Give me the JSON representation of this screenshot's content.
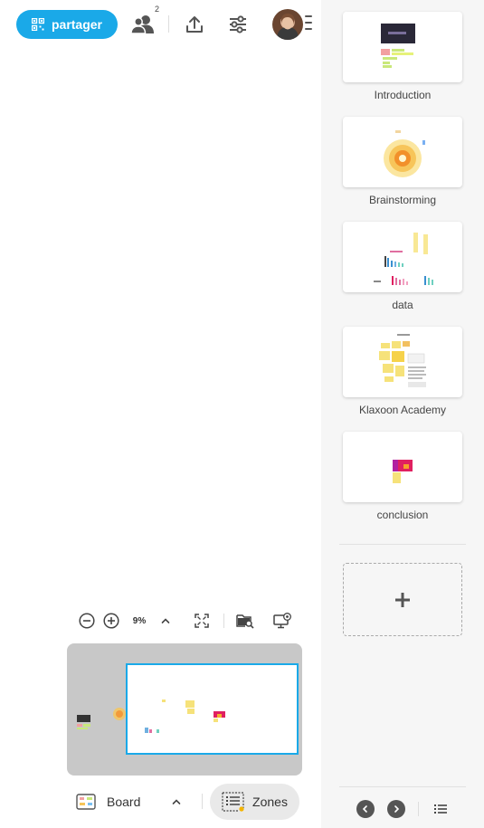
{
  "toolbar": {
    "share_label": "partager",
    "users_count": "2"
  },
  "zoom": {
    "level": "9%"
  },
  "bottom": {
    "board_label": "Board",
    "zones_label": "Zones"
  },
  "zones": [
    {
      "label": "Introduction"
    },
    {
      "label": "Brainstorming"
    },
    {
      "label": "data"
    },
    {
      "label": "Klaxoon Academy"
    },
    {
      "label": "conclusion"
    }
  ],
  "add_zone_symbol": "+",
  "colors": {
    "accent": "#1aa9e8",
    "panel_bg": "#f6f6f6",
    "minimap_bg": "#c8c8c8",
    "zones_button_bg": "#e9e9e9"
  },
  "icons": {
    "share": "qr-code-icon",
    "users": "users-icon",
    "export": "upload-icon",
    "settings": "sliders-icon",
    "avatar_menu": "menu-icon",
    "zoom_out": "minus-circle-icon",
    "zoom_in": "plus-circle-icon",
    "zoom_menu": "chevron-up-icon",
    "fit": "fit-screen-icon",
    "search_board": "folder-search-icon",
    "presentation": "monitor-gear-icon",
    "board": "board-icon",
    "zones": "zones-list-icon",
    "prev": "chevron-left-icon",
    "next": "chevron-right-icon",
    "list": "list-icon"
  }
}
